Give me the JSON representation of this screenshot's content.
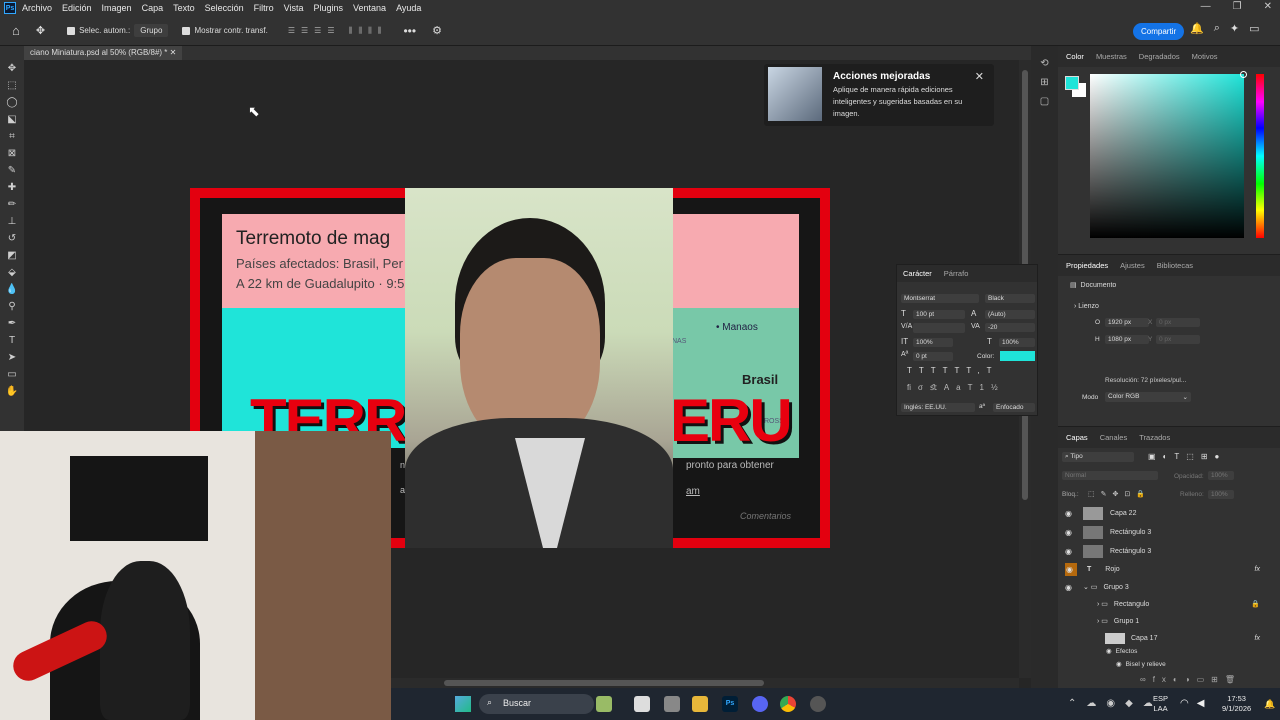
{
  "app": {
    "logo": "Ps",
    "menu": [
      "Archivo",
      "Edición",
      "Imagen",
      "Capa",
      "Texto",
      "Selección",
      "Filtro",
      "Vista",
      "Plugins",
      "Ventana",
      "Ayuda"
    ]
  },
  "options": {
    "auto_select": "Selec. autom.:",
    "group": "Grupo",
    "show_transform": "Mostrar contr. transf.",
    "share": "Compartir"
  },
  "document": {
    "tab": "ciano Miniatura.psd al 50% (RGB/8#) *"
  },
  "thumbnail": {
    "title": "Terremoto de mag",
    "countries": "Países afectados: Brasil, Per",
    "location": "A 22 km de Guadalupito · 9:5",
    "big_left": "TERRE",
    "big_right": "ERU",
    "map_city": "Manaos",
    "map_country": "Brasil",
    "map_frag1": "NAS",
    "map_frag2": "ROSSO",
    "promo": "pronto para obtener",
    "link": "am",
    "comments": "Comentarios",
    "side1": "n",
    "side2": "a"
  },
  "notification": {
    "title": "Acciones mejoradas",
    "body": "Aplique de manera rápida ediciones inteligentes y sugeridas basadas en su imagen."
  },
  "color_panel": {
    "tabs": [
      "Color",
      "Muestras",
      "Degradados",
      "Motivos"
    ],
    "accent": "#1fe4d9"
  },
  "character": {
    "tabs": [
      "Carácter",
      "Párrafo"
    ],
    "font": "Montserrat",
    "style": "Black",
    "size": "100 pt",
    "leading": "(Auto)",
    "tracking": "-20",
    "vscale": "100%",
    "hscale": "100%",
    "baseline": "0 pt",
    "color_label": "Color:",
    "lang": "Inglés: EE.UU.",
    "aa": "Enfocado",
    "aa_icon": "aª"
  },
  "properties": {
    "tabs": [
      "Propiedades",
      "Ajustes",
      "Bibliotecas"
    ],
    "doc": "Documento",
    "canvas": "Lienzo",
    "w_label": "O",
    "w": "1920 px",
    "h_label": "H",
    "h": "1080 px",
    "x_label": "X",
    "x": "0 px",
    "y_label": "Y",
    "y": "0 px",
    "resolution": "Resolución: 72 píxeles/pul...",
    "mode_label": "Modo",
    "mode": "Color RGB"
  },
  "layers": {
    "tabs": [
      "Capas",
      "Canales",
      "Trazados"
    ],
    "filter": "Tipo",
    "blend": "Normal",
    "opacity_label": "Opacidad:",
    "opacity": "100%",
    "lock_label": "Bloq.:",
    "fill_label": "Relleno:",
    "fill": "100%",
    "items": [
      {
        "name": "Capa 22",
        "icon": "image"
      },
      {
        "name": "Rectángulo 3",
        "icon": "shape"
      },
      {
        "name": "Rectángulo 3",
        "icon": "shape"
      },
      {
        "name": "Rojo",
        "icon": "text",
        "fx": "fx"
      },
      {
        "name": "Grupo 3",
        "icon": "folder"
      },
      {
        "name": "Rectangulo",
        "icon": "folder"
      },
      {
        "name": "Grupo 1",
        "icon": "folder"
      },
      {
        "name": "Capa 17",
        "icon": "image",
        "fx": "fx"
      },
      {
        "name": "Efectos",
        "icon": "effect"
      },
      {
        "name": "Bisel y relieve",
        "icon": "effect"
      }
    ]
  },
  "taskbar": {
    "search": "Buscar",
    "lang1": "ESP",
    "lang2": "LAA",
    "time": "17:53",
    "date": "9/1/2026"
  }
}
